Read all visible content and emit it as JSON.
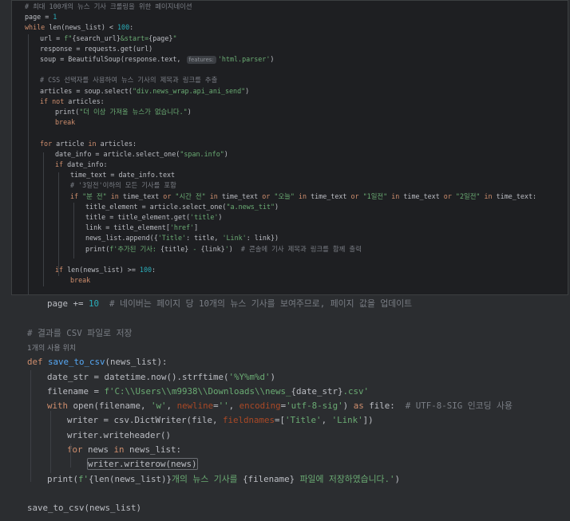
{
  "top_lines": [
    {
      "indent": 0,
      "parts": [
        [
          "cmt",
          "# 최대 100개의 뉴스 기사 크롤링을 위한 페이지네이션"
        ]
      ]
    },
    {
      "indent": 0,
      "parts": [
        [
          "",
          "page = "
        ],
        [
          "num",
          "1"
        ]
      ]
    },
    {
      "indent": 0,
      "parts": [
        [
          "kw",
          "while "
        ],
        [
          "",
          "len(news_list) < "
        ],
        [
          "num",
          "100"
        ],
        [
          "",
          ":"
        ]
      ]
    },
    {
      "indent": 1,
      "parts": [
        [
          "",
          "url = "
        ],
        [
          "str",
          "f\""
        ],
        [
          "",
          "{search_url}"
        ],
        [
          "str",
          "&start="
        ],
        [
          "",
          "{page}"
        ],
        [
          "str",
          "\""
        ]
      ]
    },
    {
      "indent": 1,
      "parts": [
        [
          "",
          "response = requests.get(url)"
        ]
      ]
    },
    {
      "indent": 1,
      "parts": [
        [
          "",
          "soup = BeautifulSoup(response.text, "
        ],
        [
          "hint",
          "features:"
        ],
        [
          "str",
          "'html.parser'"
        ],
        [
          "",
          ")"
        ]
      ]
    },
    {
      "indent": 0,
      "parts": []
    },
    {
      "indent": 1,
      "parts": [
        [
          "cmt",
          "# CSS 선택자를 사용하여 뉴스 기사의 제목과 링크를 추출"
        ]
      ]
    },
    {
      "indent": 1,
      "parts": [
        [
          "",
          "articles = soup.select("
        ],
        [
          "str",
          "\"div.news_wrap.api_ani_send\""
        ],
        [
          "",
          ")"
        ]
      ]
    },
    {
      "indent": 1,
      "parts": [
        [
          "kw",
          "if not "
        ],
        [
          "",
          "articles:"
        ]
      ]
    },
    {
      "indent": 2,
      "parts": [
        [
          "",
          "print("
        ],
        [
          "str",
          "\"더 이상 가져올 뉴스가 없습니다.\""
        ],
        [
          "",
          ")"
        ]
      ]
    },
    {
      "indent": 2,
      "parts": [
        [
          "kw",
          "break"
        ]
      ]
    },
    {
      "indent": 0,
      "parts": []
    },
    {
      "indent": 1,
      "parts": [
        [
          "kw",
          "for "
        ],
        [
          "",
          "article "
        ],
        [
          "kw",
          "in "
        ],
        [
          "",
          "articles:"
        ]
      ]
    },
    {
      "indent": 2,
      "parts": [
        [
          "",
          "date_info = article.select_one("
        ],
        [
          "str",
          "\"span.info\""
        ],
        [
          "",
          ")"
        ]
      ]
    },
    {
      "indent": 2,
      "parts": [
        [
          "kw",
          "if "
        ],
        [
          "",
          "date_info:"
        ]
      ]
    },
    {
      "indent": 3,
      "parts": [
        [
          "",
          "time_text = date_info.text"
        ]
      ]
    },
    {
      "indent": 3,
      "parts": [
        [
          "cmt",
          "# '3일전'이하의 모든 기사를 포함"
        ]
      ]
    },
    {
      "indent": 3,
      "parts": [
        [
          "kw",
          "if "
        ],
        [
          "str",
          "\"분 전\""
        ],
        [
          "kw",
          " in "
        ],
        [
          "",
          "time_text "
        ],
        [
          "kw",
          "or "
        ],
        [
          "str",
          "\"시간 전\""
        ],
        [
          "kw",
          " in "
        ],
        [
          "",
          "time_text "
        ],
        [
          "kw",
          "or "
        ],
        [
          "str",
          "\"오늘\""
        ],
        [
          "kw",
          " in "
        ],
        [
          "",
          "time_text "
        ],
        [
          "kw",
          "or "
        ],
        [
          "str",
          "\"1일전\""
        ],
        [
          "kw",
          " in "
        ],
        [
          "",
          "time_text "
        ],
        [
          "kw",
          "or "
        ],
        [
          "str",
          "\"2일전\""
        ],
        [
          "kw",
          " in "
        ],
        [
          "",
          "time_text:"
        ]
      ]
    },
    {
      "indent": 4,
      "parts": [
        [
          "",
          "title_element = article.select_one("
        ],
        [
          "str",
          "\"a.news_tit\""
        ],
        [
          "",
          ")"
        ]
      ]
    },
    {
      "indent": 4,
      "parts": [
        [
          "",
          "title = title_element.get("
        ],
        [
          "str",
          "'title'"
        ],
        [
          "",
          ")"
        ]
      ]
    },
    {
      "indent": 4,
      "parts": [
        [
          "",
          "link = title_element["
        ],
        [
          "str",
          "'href'"
        ],
        [
          "",
          "]"
        ]
      ]
    },
    {
      "indent": 4,
      "parts": [
        [
          "",
          "news_list.append({"
        ],
        [
          "str",
          "'Title'"
        ],
        [
          "",
          ": title, "
        ],
        [
          "str",
          "'Link'"
        ],
        [
          "",
          ": link})"
        ]
      ]
    },
    {
      "indent": 4,
      "parts": [
        [
          "",
          "print("
        ],
        [
          "str",
          "f'추가된 기사: "
        ],
        [
          "",
          "{title}"
        ],
        [
          "str",
          " - "
        ],
        [
          "",
          "{link}"
        ],
        [
          "str",
          "'"
        ],
        [
          "",
          ")  "
        ],
        [
          "cmt",
          "# 콘솔에 기사 제목과 링크를 함께 출력"
        ]
      ]
    },
    {
      "indent": 0,
      "parts": []
    },
    {
      "indent": 2,
      "parts": [
        [
          "kw",
          "if "
        ],
        [
          "",
          "len(news_list) >= "
        ],
        [
          "num",
          "100"
        ],
        [
          "",
          ":"
        ]
      ]
    },
    {
      "indent": 3,
      "parts": [
        [
          "kw",
          "break"
        ]
      ]
    }
  ],
  "bottom_lines": [
    {
      "indent": 1,
      "parts": [
        [
          "",
          "page += "
        ],
        [
          "num",
          "10"
        ],
        [
          "",
          "  "
        ],
        [
          "cmt",
          "# 네이버는 페이지 당 10개의 뉴스 기사를 보여주므로, 페이지 값을 업데이트"
        ]
      ]
    },
    {
      "indent": 0,
      "parts": []
    },
    {
      "indent": 0,
      "parts": [
        [
          "cmt",
          "# 결과를 CSV 파일로 저장"
        ]
      ]
    },
    {
      "indent": 0,
      "parts": [
        [
          "usage",
          "1개의 사용 위치"
        ]
      ]
    },
    {
      "indent": 0,
      "parts": [
        [
          "kw",
          "def "
        ],
        [
          "fn",
          "save_to_csv"
        ],
        [
          "",
          "(news_list):"
        ]
      ]
    },
    {
      "indent": 1,
      "parts": [
        [
          "",
          "date_str = datetime.now().strftime("
        ],
        [
          "str",
          "'%Y%m%d'"
        ],
        [
          "",
          ")"
        ]
      ]
    },
    {
      "indent": 1,
      "parts": [
        [
          "",
          "filename = "
        ],
        [
          "str",
          "f'C:\\\\Users\\\\m9938\\\\Downloads\\\\news_"
        ],
        [
          "",
          "{date_str}"
        ],
        [
          "str",
          ".csv'"
        ]
      ]
    },
    {
      "indent": 1,
      "parts": [
        [
          "kw",
          "with "
        ],
        [
          "",
          "open(filename, "
        ],
        [
          "str",
          "'w'"
        ],
        [
          "",
          ", "
        ],
        [
          "param",
          "newline"
        ],
        [
          "",
          "="
        ],
        [
          "str",
          "''"
        ],
        [
          "",
          ", "
        ],
        [
          "param",
          "encoding"
        ],
        [
          "",
          "="
        ],
        [
          "str",
          "'utf-8-sig'"
        ],
        [
          "",
          ") "
        ],
        [
          "kw",
          "as "
        ],
        [
          "",
          "file:  "
        ],
        [
          "cmt",
          "# UTF-8-SIG 인코딩 사용"
        ]
      ]
    },
    {
      "indent": 2,
      "parts": [
        [
          "",
          "writer = csv.DictWriter(file, "
        ],
        [
          "param",
          "fieldnames"
        ],
        [
          "",
          "=["
        ],
        [
          "str",
          "'Title'"
        ],
        [
          "",
          ", "
        ],
        [
          "str",
          "'Link'"
        ],
        [
          "",
          "])"
        ]
      ]
    },
    {
      "indent": 2,
      "parts": [
        [
          "",
          "writer.writeheader()"
        ]
      ]
    },
    {
      "indent": 2,
      "parts": [
        [
          "kw",
          "for "
        ],
        [
          "",
          "news "
        ],
        [
          "kw",
          "in "
        ],
        [
          "",
          "news_list:"
        ]
      ]
    },
    {
      "indent": 3,
      "parts": [
        [
          "caret",
          "writer.writerow(news)"
        ]
      ]
    },
    {
      "indent": 1,
      "parts": [
        [
          "",
          "print("
        ],
        [
          "str",
          "f'"
        ],
        [
          "",
          "{len(news_list)}"
        ],
        [
          "str",
          "개의 뉴스 기사를 "
        ],
        [
          "",
          "{filename}"
        ],
        [
          "str",
          " 파일에 저장하였습니다.'"
        ],
        [
          "",
          ")"
        ]
      ]
    },
    {
      "indent": 0,
      "parts": []
    },
    {
      "indent": 0,
      "parts": [
        [
          "",
          "save_to_csv(news_list)"
        ]
      ]
    }
  ],
  "colors": {
    "background": "#1e1f22",
    "keyword": "#cf8e6d",
    "string": "#6aab73",
    "number": "#2aacb8",
    "comment": "#7a7e85",
    "function": "#56a8f5"
  }
}
